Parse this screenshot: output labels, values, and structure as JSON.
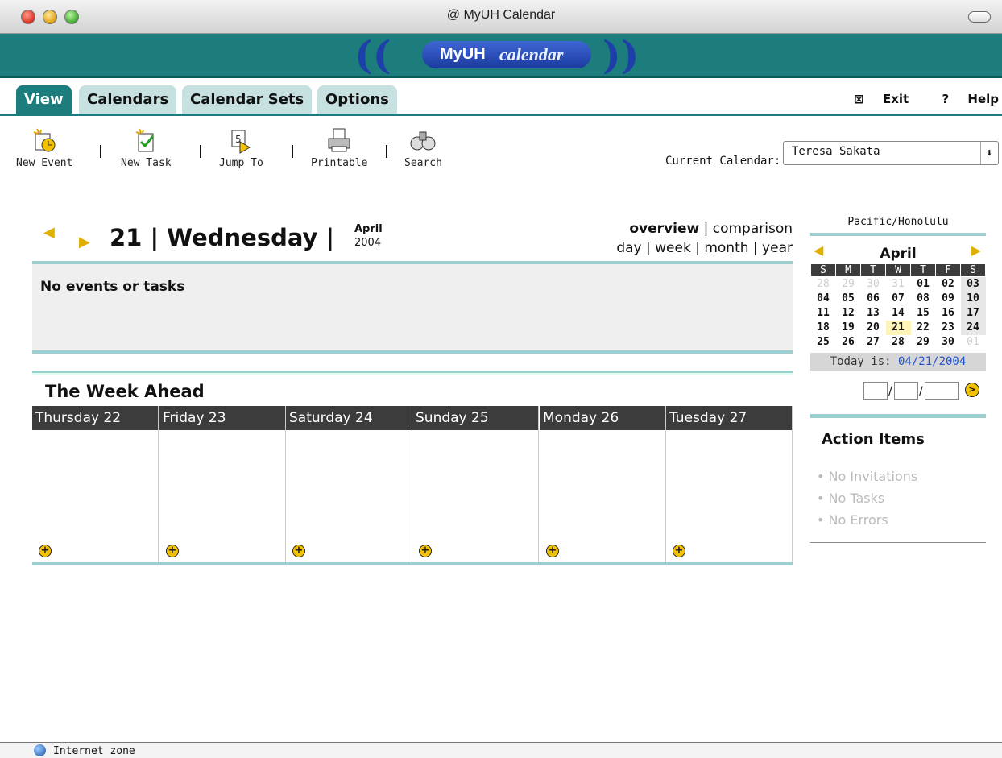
{
  "window": {
    "title": "@ MyUH Calendar"
  },
  "banner": {
    "logo_left": "MyUH",
    "logo_right": "calendar"
  },
  "tabs": [
    {
      "label": "View",
      "active": true
    },
    {
      "label": "Calendars"
    },
    {
      "label": "Calendar Sets"
    },
    {
      "label": "Options"
    }
  ],
  "toplinks": {
    "exit": "Exit",
    "help": "Help",
    "exit_icon": "⊠",
    "help_icon": "?"
  },
  "toolbar": {
    "new_event": "New Event",
    "new_task": "New Task",
    "jump_to": "Jump To",
    "printable": "Printable",
    "search": "Search",
    "current_calendar_label": "Current Calendar:",
    "current_calendar_value": "Teresa Sakata"
  },
  "day": {
    "title": "21 | Wednesday |",
    "month": "April",
    "year": "2004",
    "views_line1_bold": "overview",
    "views_line1_rest": " | comparison",
    "views_line2": "day | week | month | year",
    "empty_msg": "No events or tasks"
  },
  "week": {
    "title": "The Week Ahead",
    "days": [
      "Thursday 22",
      "Friday 23",
      "Saturday 24",
      "Sunday 25",
      "Monday 26",
      "Tuesday 27"
    ]
  },
  "mini_cal": {
    "timezone": "Pacific/Honolulu",
    "month": "April",
    "weekdays": [
      "S",
      "M",
      "T",
      "W",
      "T",
      "F",
      "S"
    ],
    "weeks": [
      [
        "28",
        "29",
        "30",
        "31",
        "01",
        "02",
        "03"
      ],
      [
        "04",
        "05",
        "06",
        "07",
        "08",
        "09",
        "10"
      ],
      [
        "11",
        "12",
        "13",
        "14",
        "15",
        "16",
        "17"
      ],
      [
        "18",
        "19",
        "20",
        "21",
        "22",
        "23",
        "24"
      ],
      [
        "25",
        "26",
        "27",
        "28",
        "29",
        "30",
        "01"
      ]
    ],
    "today_label": "Today is:",
    "today_value": "04/21/2004"
  },
  "action_items": {
    "title": "Action Items",
    "items": [
      "No Invitations",
      "No Tasks",
      "No Errors"
    ]
  },
  "status": {
    "zone": "Internet zone"
  },
  "colors": {
    "teal": "#1c7d7c",
    "light_teal": "#9ccfcf",
    "accent": "#f2c200"
  }
}
